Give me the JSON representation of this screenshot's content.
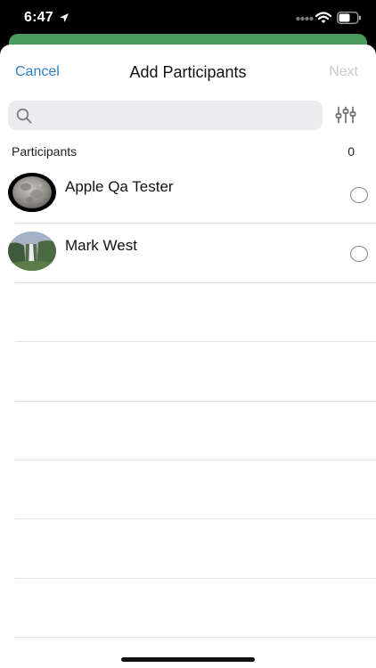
{
  "status_bar": {
    "time": "6:47",
    "icons": [
      "location-arrow-icon",
      "cell-signal-icon",
      "wifi-icon",
      "battery-icon"
    ]
  },
  "nav": {
    "cancel_label": "Cancel",
    "title": "Add Participants",
    "next_label": "Next"
  },
  "search": {
    "placeholder": "",
    "value": ""
  },
  "section": {
    "label": "Participants",
    "count": "0"
  },
  "participants": [
    {
      "name": "Apple Qa Tester",
      "avatar": "moon-photo",
      "selected": false
    },
    {
      "name": "Mark West",
      "avatar": "waterfall-photo",
      "selected": false
    }
  ],
  "colors": {
    "accent": "#2a7fc6",
    "disabled": "#c9c9c9",
    "search_bg": "#ececee",
    "underlay_green": "#4a9a5e"
  }
}
